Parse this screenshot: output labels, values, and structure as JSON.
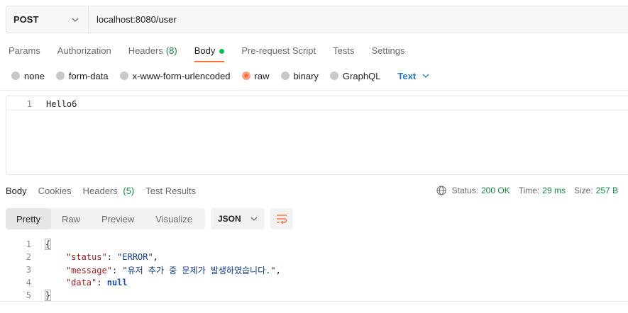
{
  "request": {
    "method": "POST",
    "url": "localhost:8080/user"
  },
  "request_tabs": [
    {
      "label": "Params"
    },
    {
      "label": "Authorization"
    },
    {
      "label": "Headers",
      "count": "(8)"
    },
    {
      "label": "Body"
    },
    {
      "label": "Pre-request Script"
    },
    {
      "label": "Tests"
    },
    {
      "label": "Settings"
    }
  ],
  "body_types": [
    {
      "label": "none"
    },
    {
      "label": "form-data"
    },
    {
      "label": "x-www-form-urlencoded"
    },
    {
      "label": "raw"
    },
    {
      "label": "binary"
    },
    {
      "label": "GraphQL"
    }
  ],
  "raw_format": "Text",
  "request_body": {
    "line_number": "1",
    "content": "Hello6"
  },
  "response_tabs": [
    {
      "label": "Body"
    },
    {
      "label": "Cookies"
    },
    {
      "label": "Headers",
      "count": "(5)"
    },
    {
      "label": "Test Results"
    }
  ],
  "response_status": {
    "status_label": "Status:",
    "status_value": "200 OK",
    "time_label": "Time:",
    "time_value": "29 ms",
    "size_label": "Size:",
    "size_value": "257 B"
  },
  "view_modes": [
    {
      "label": "Pretty"
    },
    {
      "label": "Raw"
    },
    {
      "label": "Preview"
    },
    {
      "label": "Visualize"
    }
  ],
  "response_format": "JSON",
  "response_body": {
    "line_numbers": [
      "1",
      "2",
      "3",
      "4",
      "5"
    ],
    "open_brace": "{",
    "close_brace": "}",
    "status_key": "\"status\"",
    "status_value": "\"ERROR\"",
    "message_key": "\"message\"",
    "message_value": "\"유저 추가 중 문제가 발생하였습니다.\"",
    "data_key": "\"data\"",
    "data_value": "null"
  },
  "colors": {
    "accent": "#ff6c37",
    "success": "#0f8a3d",
    "link": "#1d78c1"
  }
}
